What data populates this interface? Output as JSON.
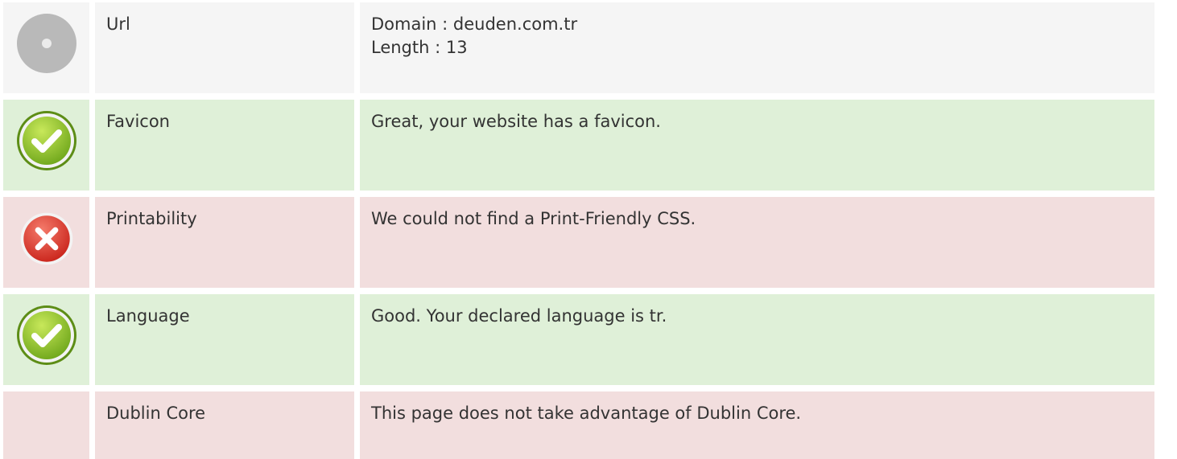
{
  "rows": [
    {
      "status": "neutral",
      "icon": "info-circle-icon",
      "label": "Url",
      "lines": [
        "Domain : deuden.com.tr",
        "Length : 13"
      ]
    },
    {
      "status": "good",
      "icon": "check-icon",
      "label": "Favicon",
      "lines": [
        "Great, your website has a favicon."
      ]
    },
    {
      "status": "bad",
      "icon": "cross-icon",
      "label": "Printability",
      "lines": [
        "We could not find a Print-Friendly CSS."
      ]
    },
    {
      "status": "good",
      "icon": "check-icon",
      "label": "Language",
      "lines": [
        "Good. Your declared language is tr."
      ]
    },
    {
      "status": "bad",
      "icon": "",
      "label": "Dublin Core",
      "lines": [
        "This page does not take advantage of Dublin Core."
      ]
    }
  ],
  "colors": {
    "neutral": "#f5f5f5",
    "good": "#dff0d8",
    "bad": "#f2dede"
  }
}
